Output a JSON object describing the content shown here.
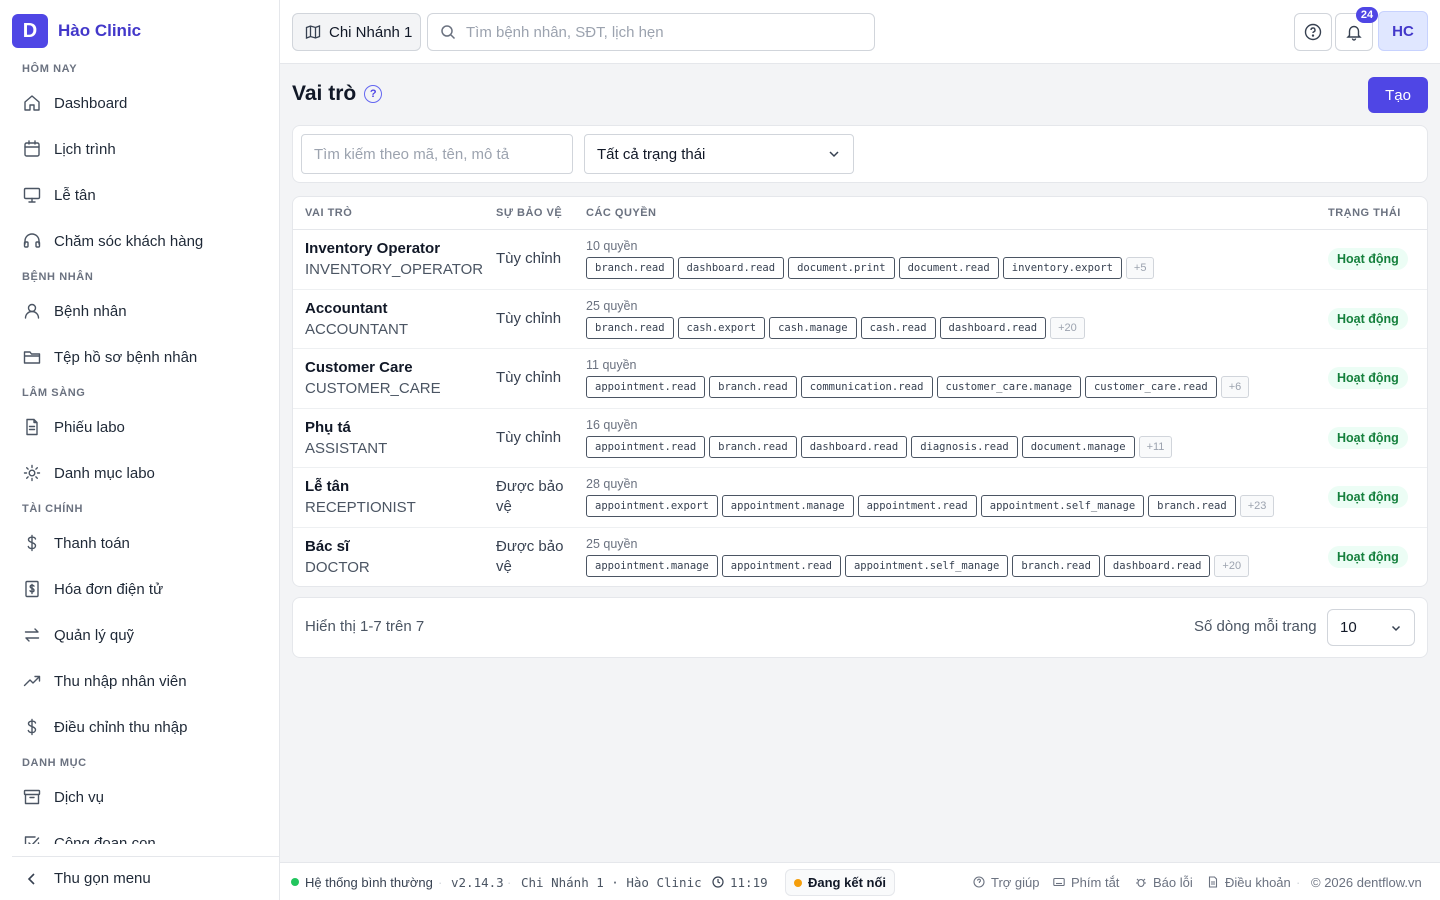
{
  "brand": {
    "logo_letter": "D",
    "name": "Hào Clinic",
    "accent": "#4f46e5"
  },
  "sidebar": {
    "sections": [
      {
        "title": "HÔM NAY",
        "items": [
          {
            "label": "Dashboard",
            "icon": "home-icon"
          },
          {
            "label": "Lịch trình",
            "icon": "calendar-icon"
          },
          {
            "label": "Lễ tân",
            "icon": "monitor-icon"
          },
          {
            "label": "Chăm sóc khách hàng",
            "icon": "headphones-icon"
          }
        ]
      },
      {
        "title": "BỆNH NHÂN",
        "items": [
          {
            "label": "Bệnh nhân",
            "icon": "user-icon"
          },
          {
            "label": "Tệp hồ sơ bệnh nhân",
            "icon": "folder-icon"
          }
        ]
      },
      {
        "title": "LÂM SÀNG",
        "items": [
          {
            "label": "Phiếu labo",
            "icon": "document-icon"
          },
          {
            "label": "Danh mục labo",
            "icon": "gear-icon"
          }
        ]
      },
      {
        "title": "TÀI CHÍNH",
        "items": [
          {
            "label": "Thanh toán",
            "icon": "dollar-icon"
          },
          {
            "label": "Hóa đơn điện tử",
            "icon": "invoice-icon"
          },
          {
            "label": "Quản lý quỹ",
            "icon": "transfer-icon"
          },
          {
            "label": "Thu nhập nhân viên",
            "icon": "trending-up-icon"
          },
          {
            "label": "Điều chỉnh thu nhập",
            "icon": "dollar-icon"
          }
        ]
      },
      {
        "title": "DANH MỤC",
        "items": [
          {
            "label": "Dịch vụ",
            "icon": "archive-icon"
          },
          {
            "label": "Công đoạn con",
            "icon": "checklist-icon"
          }
        ]
      }
    ],
    "collapse_label": "Thu gọn menu"
  },
  "topbar": {
    "branch_label": "Chi Nhánh 1",
    "search_placeholder": "Tìm bệnh nhân, SĐT, lịch hẹn",
    "notification_count": "24",
    "avatar_initials": "HC"
  },
  "page": {
    "title": "Vai trò",
    "help_mark": "?",
    "create_label": "Tạo",
    "filter_search_placeholder": "Tìm kiếm theo mã, tên, mô tả",
    "status_filter_value": "Tất cả trạng thái"
  },
  "table": {
    "columns": {
      "role": "VAI TRÒ",
      "protection": "SỰ BẢO VỆ",
      "permissions": "CÁC QUYỀN",
      "status": "TRẠNG THÁI"
    },
    "rows": [
      {
        "name": "Inventory Operator",
        "code": "INVENTORY_OPERATOR",
        "protection": "Tùy chỉnh",
        "count": "10 quyền",
        "perms": [
          "branch.read",
          "dashboard.read",
          "document.print",
          "document.read",
          "inventory.export"
        ],
        "more": "+5",
        "status": "Hoạt động"
      },
      {
        "name": "Accountant",
        "code": "ACCOUNTANT",
        "protection": "Tùy chỉnh",
        "count": "25 quyền",
        "perms": [
          "branch.read",
          "cash.export",
          "cash.manage",
          "cash.read",
          "dashboard.read"
        ],
        "more": "+20",
        "status": "Hoạt động"
      },
      {
        "name": "Customer Care",
        "code": "CUSTOMER_CARE",
        "protection": "Tùy chỉnh",
        "count": "11 quyền",
        "perms": [
          "appointment.read",
          "branch.read",
          "communication.read",
          "customer_care.manage",
          "customer_care.read"
        ],
        "more": "+6",
        "status": "Hoạt động"
      },
      {
        "name": "Phụ tá",
        "code": "ASSISTANT",
        "protection": "Tùy chỉnh",
        "count": "16 quyền",
        "perms": [
          "appointment.read",
          "branch.read",
          "dashboard.read",
          "diagnosis.read",
          "document.manage"
        ],
        "more": "+11",
        "status": "Hoạt động"
      },
      {
        "name": "Lễ tân",
        "code": "RECEPTIONIST",
        "protection": "Được bảo vệ",
        "count": "28 quyền",
        "perms": [
          "appointment.export",
          "appointment.manage",
          "appointment.read",
          "appointment.self_manage",
          "branch.read"
        ],
        "more": "+23",
        "status": "Hoạt động"
      },
      {
        "name": "Bác sĩ",
        "code": "DOCTOR",
        "protection": "Được bảo vệ",
        "count": "25 quyền",
        "perms": [
          "appointment.manage",
          "appointment.read",
          "appointment.self_manage",
          "branch.read",
          "dashboard.read"
        ],
        "more": "+20",
        "status": "Hoạt động"
      }
    ]
  },
  "pagination": {
    "info": "Hiển thị 1-7 trên 7",
    "rows_label": "Số dòng mỗi trang",
    "rows_value": "10"
  },
  "footer": {
    "system_status": "Hệ thống bình thường",
    "version": "v2.14.3",
    "branch": "Chi Nhánh 1 · Hào Clinic",
    "time": "11:19",
    "connection": "Đang kết nối",
    "links": [
      "Trợ giúp",
      "Phím tắt",
      "Báo lỗi",
      "Điều khoản"
    ],
    "copyright": "© 2026 dentflow.vn",
    "colors": {
      "ok": "#22c55e",
      "connecting": "#f59e0b",
      "active_badge": "#15803d"
    }
  }
}
